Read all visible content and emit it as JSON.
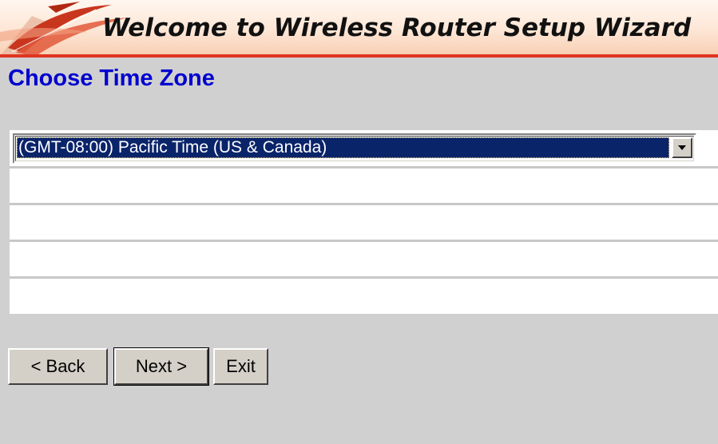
{
  "banner": {
    "title": "Welcome to Wireless Router Setup Wizard"
  },
  "page": {
    "title": "Choose Time Zone"
  },
  "timezone": {
    "selected": "(GMT-08:00) Pacific Time (US & Canada)"
  },
  "buttons": {
    "back": "< Back",
    "next": "Next >",
    "exit": "Exit"
  },
  "colors": {
    "background": "#d0d0d0",
    "title_blue": "#0000d0",
    "selection": "#0a246a",
    "banner_accent": "#e03520"
  },
  "icons": {
    "banner_logo": "red-swoosh-logo",
    "dropdown": "chevron-down-icon"
  }
}
